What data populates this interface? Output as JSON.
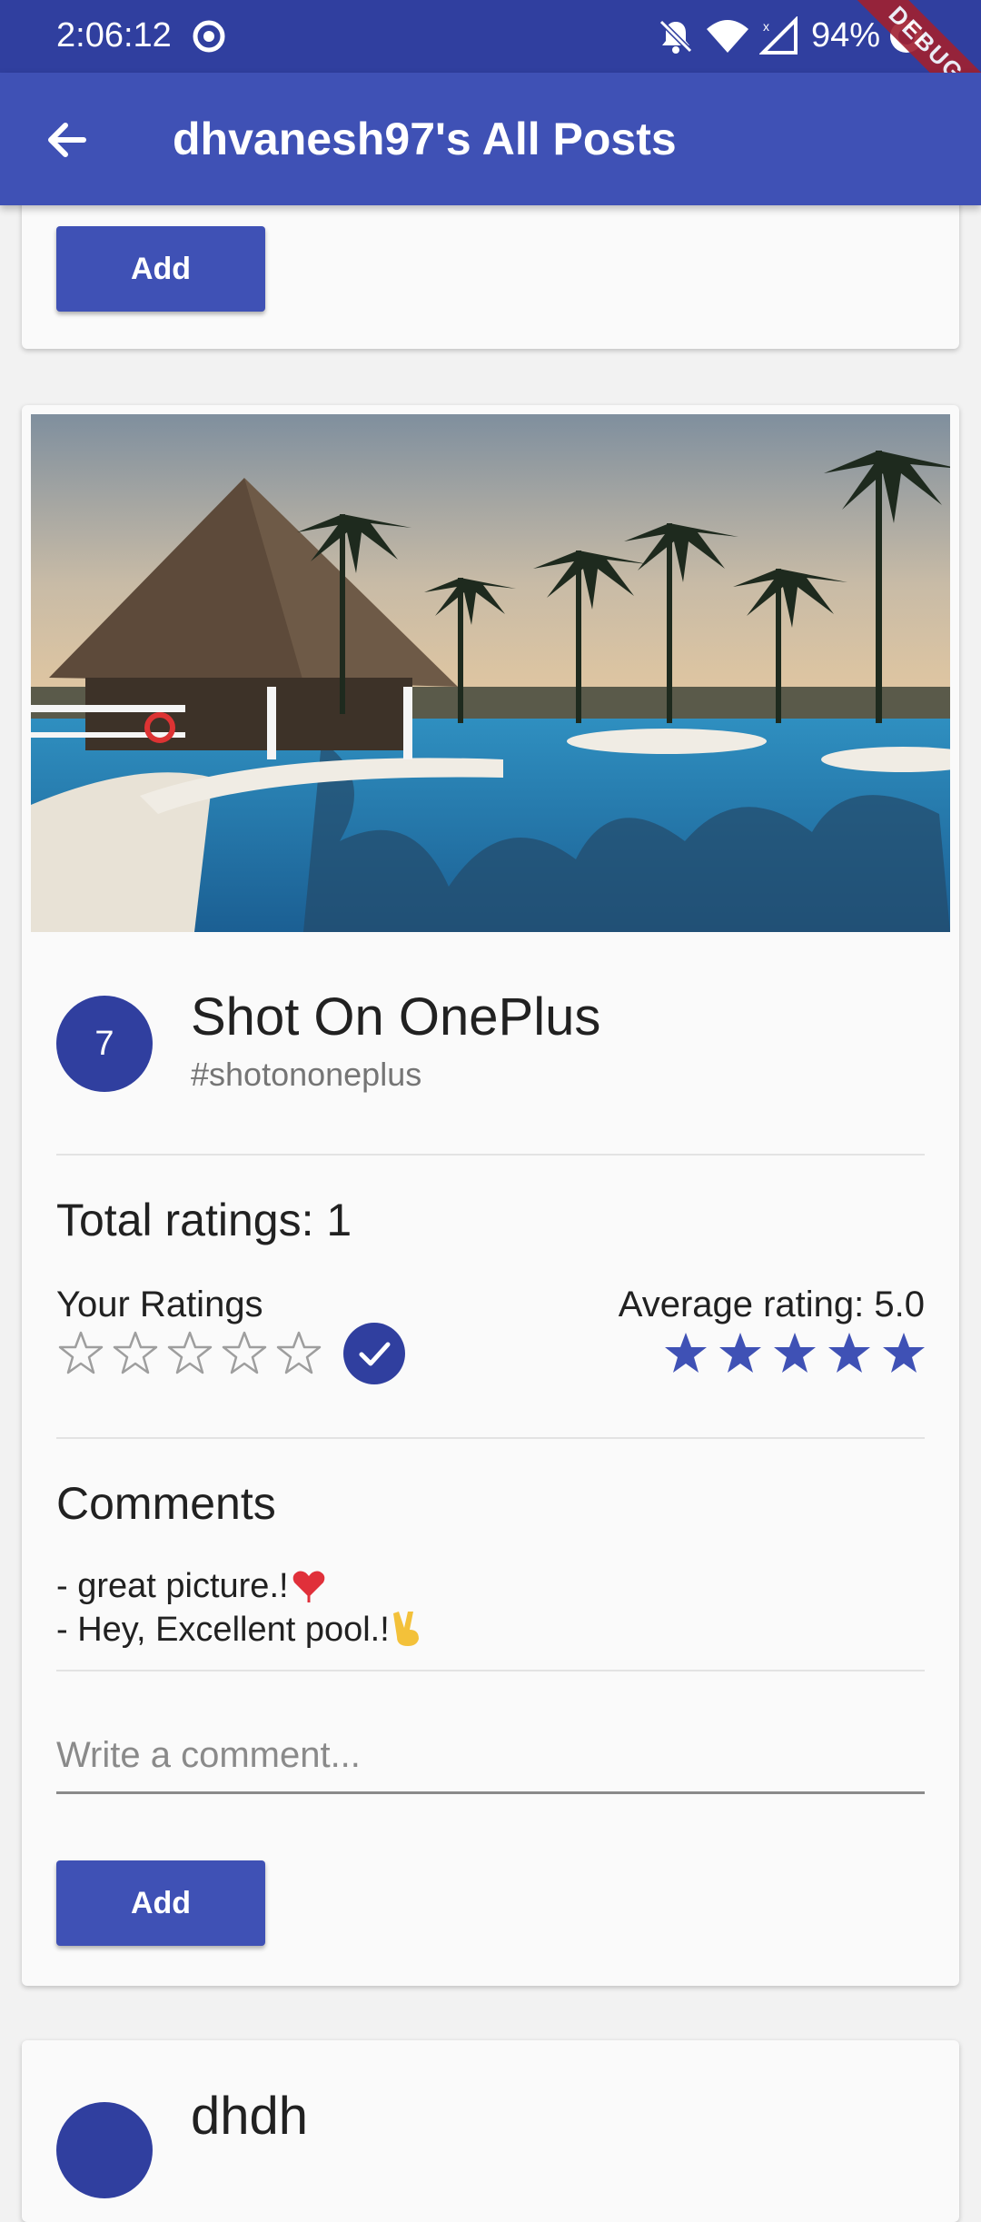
{
  "status_bar": {
    "time": "2:06:12",
    "battery": "94%",
    "debug_label": "DEBUG"
  },
  "app_bar": {
    "title": "dhvanesh97's All Posts"
  },
  "top_card": {
    "add_button": "Add"
  },
  "post": {
    "avatar_number": "7",
    "title": "Shot On OnePlus",
    "tag": "#shotononeplus",
    "total_ratings": "Total ratings: 1",
    "your_ratings_label": "Your Ratings",
    "your_rating": 0,
    "average_rating_label": "Average rating: 5.0",
    "average_rating": 5,
    "comments_heading": "Comments",
    "comments": [
      "- great picture.!",
      "- Hey, Excellent pool.!"
    ],
    "comment_placeholder": "Write a comment...",
    "add_button": "Add"
  },
  "next_post": {
    "title": "dhdh"
  },
  "colors": {
    "primary": "#3f51b5",
    "primary_dark": "#303f9f"
  }
}
